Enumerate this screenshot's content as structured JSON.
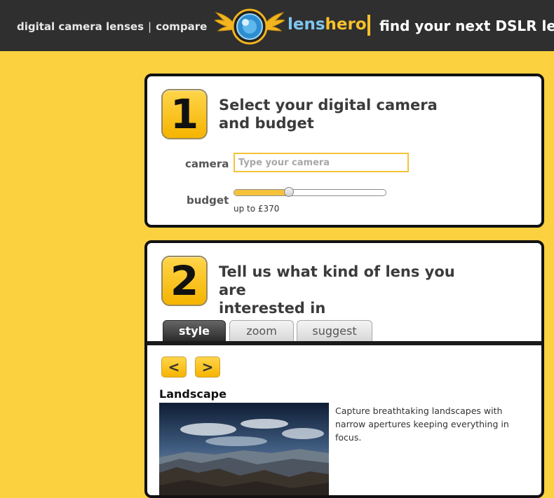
{
  "header": {
    "nav": [
      {
        "label": "digital camera lenses"
      },
      {
        "label": "compare"
      }
    ],
    "nav_separator": "|",
    "brand_part1": "lens",
    "brand_part2": "hero",
    "tagline": "find your next DSLR lens",
    "colors": {
      "bar": "#2f2f2f",
      "lens_text": "#7fc6f0",
      "hero_text": "#f6c12c"
    },
    "logo_icon": "winged-lens-logo"
  },
  "step1": {
    "number": "1",
    "heading_line1": "Select your digital camera",
    "heading_line2": "and budget",
    "camera_label": "camera",
    "camera_placeholder": "Type your camera",
    "camera_value": "",
    "budget_label": "budget",
    "budget_text": "up to £370",
    "budget_slider_fraction": 0.36
  },
  "step2": {
    "number": "2",
    "heading_line1": "Tell us what kind of lens you are",
    "heading_line2": "interested in",
    "tabs": [
      {
        "label": "style",
        "active": true
      },
      {
        "label": "zoom",
        "active": false
      },
      {
        "label": "suggest",
        "active": false
      }
    ],
    "prev_label": "<",
    "next_label": ">",
    "style_title": "Landscape",
    "style_description": "Capture breathtaking landscapes with narrow apertures keeping everything in focus."
  },
  "colors": {
    "page_background": "#fbd13f",
    "accent": "#f5c23a"
  }
}
